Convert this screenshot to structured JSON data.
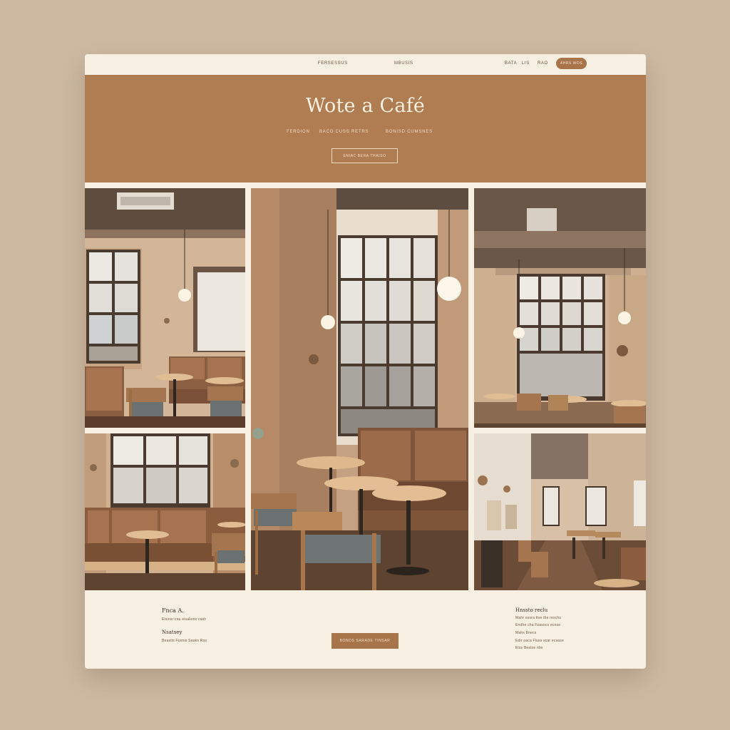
{
  "nav": {
    "links": [
      "Fersessus",
      "Mbusis",
      "Bata",
      "Lis",
      "Rao"
    ],
    "cta_label": "Ahrs Wos"
  },
  "hero": {
    "title": "Wote a Café",
    "subtitles": [
      "Ferdion",
      "Baco Cuss Retrs",
      "Bonisd Cumsnes"
    ],
    "button_label": "Eniac Bera Thaiso"
  },
  "gallery": {
    "photos": [
      "cafe-corner-booth-photo",
      "cafe-window-tables-photo",
      "cafe-dining-window-photo",
      "cafe-banquette-photo",
      "cafe-long-room-photo"
    ]
  },
  "footer": {
    "left_heading": "Fnca A.",
    "left_line_1": "Elsinsr cau eisaksnc cash",
    "left_heading_2": "Nsatsey",
    "left_line_2": "Beastis Fuenis Saaks Ras",
    "center_button_label": "Bonds Sarade Tinsar",
    "right_heading": "Hnssto reclu",
    "right_lines": [
      "Mahr ossra ttse the reschs",
      "Endhe cha Fsasocs ecnse",
      "Mahs Enecs",
      "Edir oaca Fluss scar ecsase",
      "Elss Bealse nbs"
    ]
  },
  "colors": {
    "page_background": "#cdb9a2",
    "card_background": "#f7efe2",
    "hero_background": "#b07c51",
    "accent_button": "#a8744a"
  }
}
